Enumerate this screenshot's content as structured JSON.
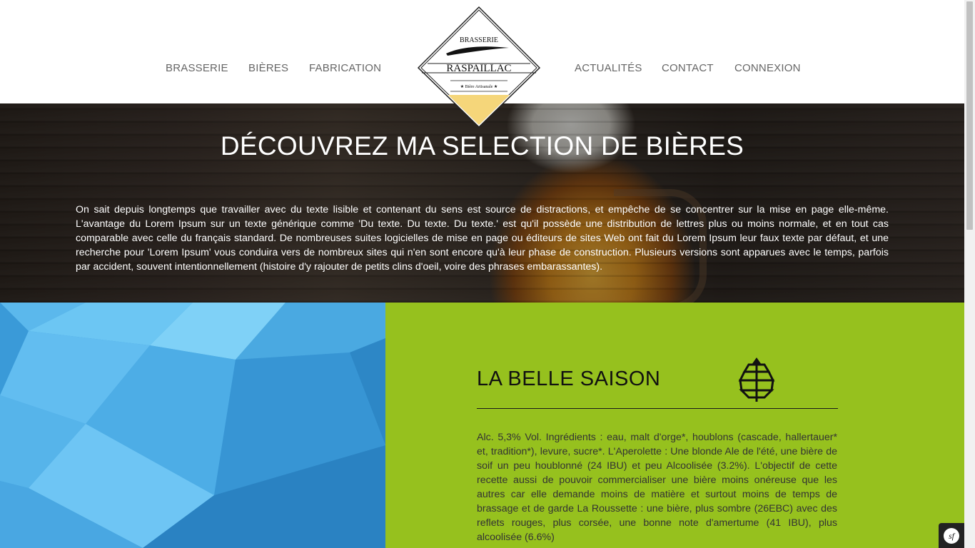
{
  "nav": {
    "left": [
      "BRASSERIE",
      "BIÈRES",
      "FABRICATION"
    ],
    "right": [
      "ACTUALITÉS",
      "CONTACT",
      "CONNEXION"
    ]
  },
  "logo": {
    "top_text": "BRASSERIE",
    "name": "RASPAILLAC",
    "tagline": "★ Bière Artisanale ★"
  },
  "hero": {
    "title": "DÉCOUVREZ MA SELECTION DE BIÈRES",
    "text": "On sait depuis longtemps que travailler avec du texte lisible et contenant du sens est source de distractions, et empêche de se concentrer sur la mise en page elle-même. L'avantage du Lorem Ipsum sur un texte générique comme 'Du texte. Du texte. Du texte.' est qu'il possède une distribution de lettres plus ou moins normale, et en tout cas comparable avec celle du français standard. De nombreuses suites logicielles de mise en page ou éditeurs de sites Web ont fait du Lorem Ipsum leur faux texte par défaut, et une recherche pour 'Lorem Ipsum' vous conduira vers de nombreux sites qui n'en sont encore qu'à leur phase de construction. Plusieurs versions sont apparues avec le temps, parfois par accident, souvent intentionnellement (histoire d'y rajouter de petits clins d'oeil, voire des phrases embarassantes)."
  },
  "beer": {
    "name": "LA BELLE SAISON",
    "icon": "hop-icon",
    "description": "Alc. 5,3% Vol. Ingrédients : eau, malt d'orge*, houblons (cascade, hallertauer* et, tradition*), levure, sucre*. L'Aperolette : Une blonde Ale de l'été, une bière de soif un peu houblonné (24 IBU) et peu Alcoolisée (3.2%). L'objectif de cette recette aussi de pouvoir commercialiser une bière moins onéreuse que les autres car elle demande moins de matière et surtout moins de temps de brassage et de garde La Roussette : une bière, plus sombre (26EBC) avec des reflets rouges, plus corsée, une bonne note d'amertume (41 IBU), plus alcoolisée (6.6%)"
  },
  "colors": {
    "accent_green": "#96c11e",
    "poly_blue": "#42a0dc",
    "logo_gold": "#f5d67a"
  },
  "debug_toolbar": {
    "icon": "symfony-icon",
    "label": "sf"
  }
}
